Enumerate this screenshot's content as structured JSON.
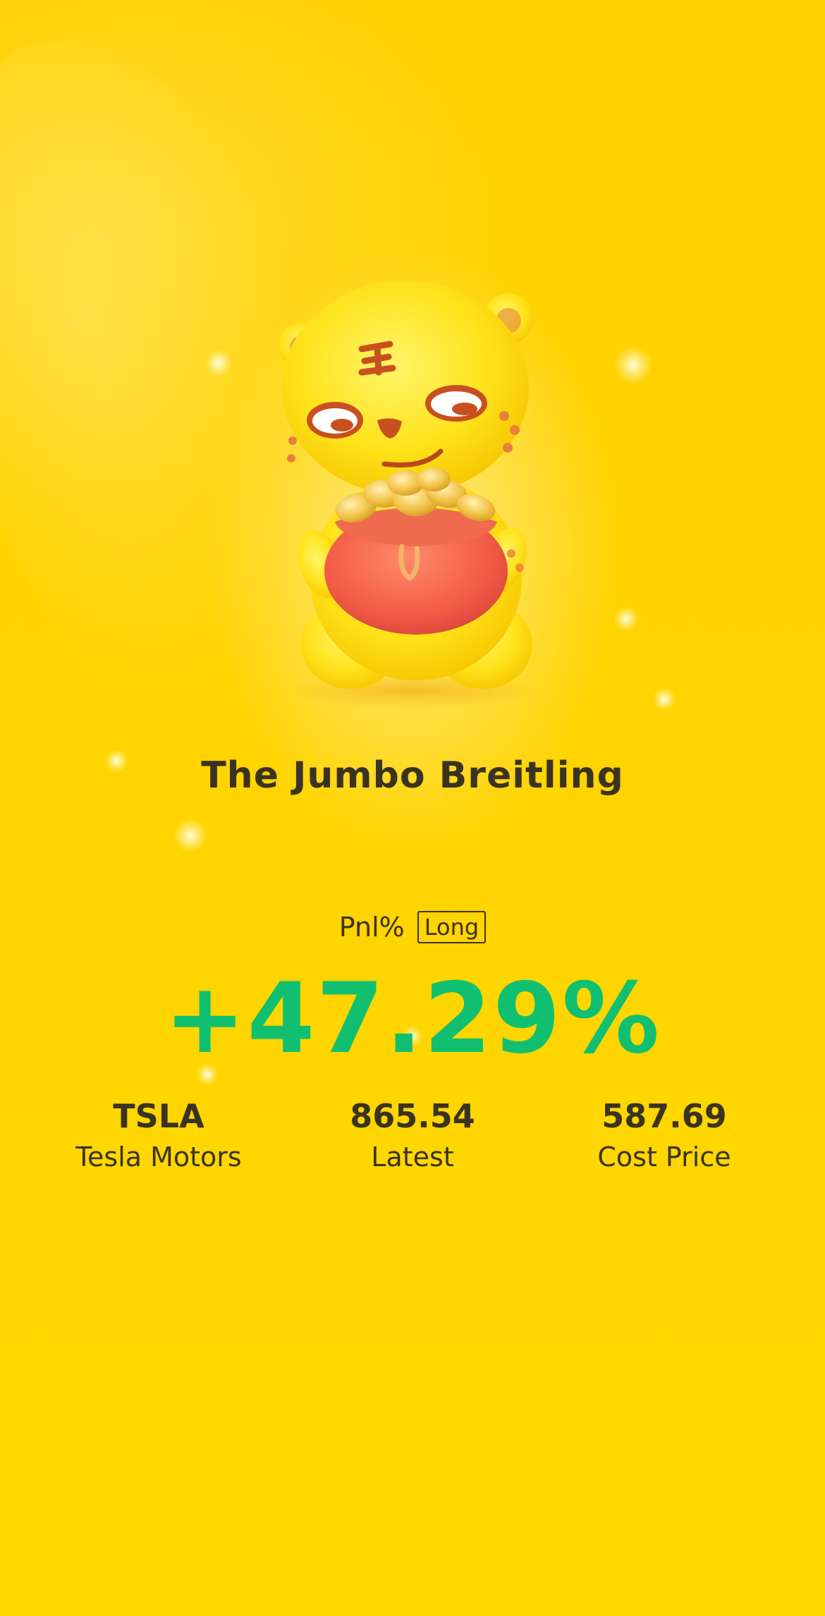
{
  "mascot": {
    "icon": "tiger-mascot-with-coin-bag-icon"
  },
  "title": "The Jumbo Breitling",
  "pnl": {
    "label": "Pnl%",
    "badge": "Long",
    "value": "+47.29%",
    "value_color": "#10c070"
  },
  "stats": [
    {
      "value": "TSLA",
      "label": "Tesla Motors"
    },
    {
      "value": "865.54",
      "label": "Latest"
    },
    {
      "value": "587.69",
      "label": "Cost Price"
    }
  ],
  "colors": {
    "background": "#ffd200",
    "text": "#3a3320",
    "positive": "#10c070"
  }
}
